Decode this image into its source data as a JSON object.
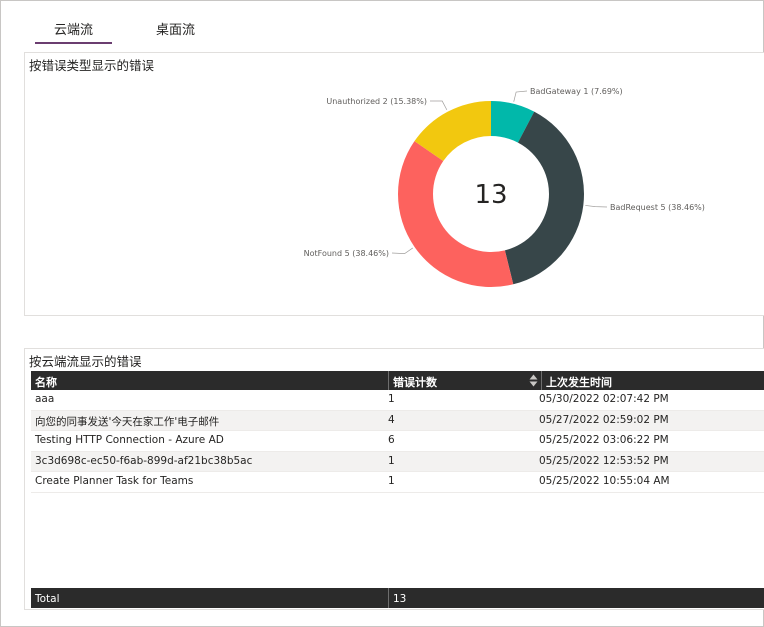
{
  "tabs": [
    {
      "label": "云端流",
      "active": true
    },
    {
      "label": "桌面流",
      "active": false
    }
  ],
  "donut_card": {
    "title": "按错误类型显示的错误",
    "center_value": "13"
  },
  "chart_data": {
    "type": "pie",
    "title": "按错误类型显示的错误",
    "total": 13,
    "slices": [
      {
        "name": "BadGateway",
        "value": 1,
        "percent": "7.69%",
        "label": "BadGateway 1 (7.69%)",
        "color": "#01b8aa"
      },
      {
        "name": "BadRequest",
        "value": 5,
        "percent": "38.46%",
        "label": "BadRequest 5 (38.46%)",
        "color": "#374649"
      },
      {
        "name": "NotFound",
        "value": 5,
        "percent": "38.46%",
        "label": "NotFound 5 (38.46%)",
        "color": "#fd625e"
      },
      {
        "name": "Unauthorized",
        "value": 2,
        "percent": "15.38%",
        "label": "Unauthorized 2 (15.38%)",
        "color": "#f2c80f"
      }
    ]
  },
  "table_card": {
    "title": "按云端流显示的错误",
    "columns": [
      "名称",
      "错误计数",
      "上次发生时间"
    ],
    "rows": [
      [
        "aaa",
        "1",
        "05/30/2022 02:07:42 PM"
      ],
      [
        "向您的同事发送'今天在家工作'电子邮件",
        "4",
        "05/27/2022 02:59:02 PM"
      ],
      [
        "Testing HTTP Connection - Azure AD",
        "6",
        "05/25/2022 03:06:22 PM"
      ],
      [
        "3c3d698c-ec50-f6ab-899d-af21bc38b5ac",
        "1",
        "05/25/2022 12:53:52 PM"
      ],
      [
        "Create Planner Task for Teams",
        "1",
        "05/25/2022 10:55:04 AM"
      ]
    ],
    "footer": {
      "label": "Total",
      "value": "13"
    }
  }
}
